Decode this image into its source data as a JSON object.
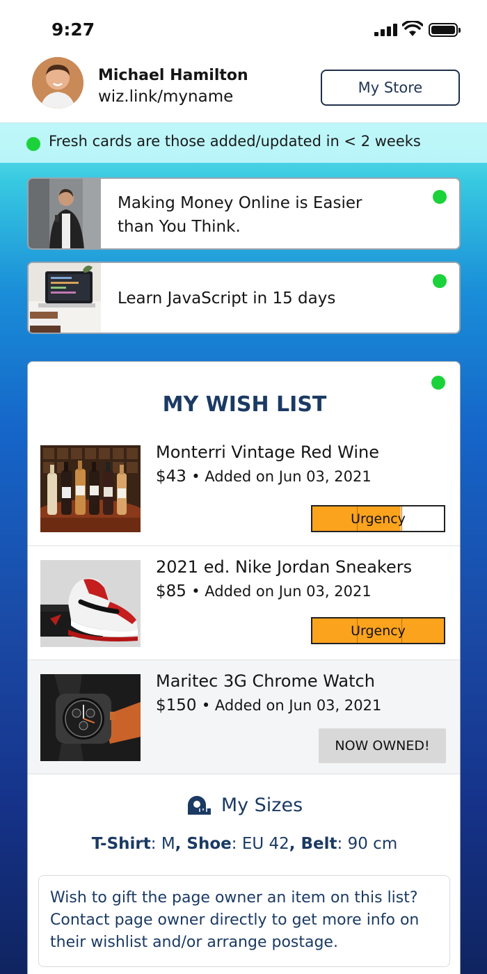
{
  "status_bar": {
    "time": "9:27"
  },
  "profile": {
    "name": "Michael Hamilton",
    "link": "wiz.link/myname"
  },
  "header": {
    "store_button": "My Store"
  },
  "banner": {
    "text": "Fresh cards are those added/updated in < 2 weeks"
  },
  "cards": [
    {
      "title_line1": "Making Money Online is Easier",
      "title_line2": "than You Think.",
      "fresh": true
    },
    {
      "title": "Learn JavaScript in 15 days",
      "fresh": true
    }
  ],
  "wishlist": {
    "title": "MY WISH LIST",
    "fresh": true,
    "items": [
      {
        "name": "Monterri Vintage Red Wine",
        "price": "$43",
        "added": "• Added on Jun 03, 2021",
        "urgency_label": "Urgency",
        "urgency_level": 0.67
      },
      {
        "name": "2021 ed. Nike Jordan Sneakers",
        "price": "$85",
        "added": "• Added on Jun 03, 2021",
        "urgency_label": "Urgency",
        "urgency_level": 1.0
      },
      {
        "name": "Maritec 3G Chrome Watch",
        "price": "$150",
        "added": "• Added on Jun 03, 2021",
        "status": "NOW OWNED!"
      }
    ]
  },
  "sizes": {
    "title": "My Sizes",
    "tshirt_label": "T-Shirt",
    "tshirt_value": ": M",
    "shoe_label": ", Shoe",
    "shoe_value": ": EU 42",
    "belt_label": ", Belt",
    "belt_value": ": 90 cm"
  },
  "gift_note": "Wish to gift the page owner an item on this list? Contact page owner directly to get more info on their wishlist and/or arrange postage.",
  "colors": {
    "accent": "#1b3a63",
    "fresh_dot": "#1bd23a",
    "urgency": "#fca31e"
  }
}
